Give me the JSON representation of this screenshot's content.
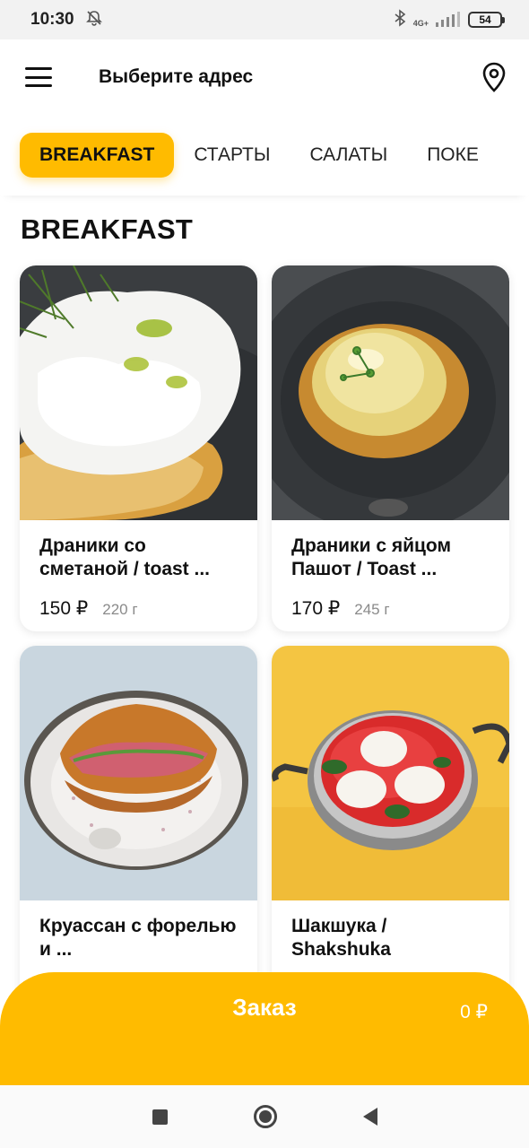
{
  "status_bar": {
    "time": "10:30",
    "network": "4G+",
    "battery": "54"
  },
  "header": {
    "address_label": "Выберите адрес"
  },
  "tabs": [
    {
      "label": "BREAKFAST",
      "active": true
    },
    {
      "label": "СТАРТЫ",
      "active": false
    },
    {
      "label": "САЛАТЫ",
      "active": false
    },
    {
      "label": "ПОКЕ",
      "active": false
    }
  ],
  "section": {
    "title": "BREAKFAST"
  },
  "products": [
    {
      "name": "Драники со сметаной / toast ...",
      "price": "150 ₽",
      "weight": "220 г"
    },
    {
      "name": "Драники с яйцом Пашот / Toast ...",
      "price": "170 ₽",
      "weight": "245 г"
    },
    {
      "name": "Круассан с форелью и ...",
      "price": "",
      "weight": ""
    },
    {
      "name": "Шакшука / Shakshuka",
      "price": "",
      "weight": ""
    }
  ],
  "order": {
    "label": "Заказ",
    "total": "0 ₽"
  },
  "colors": {
    "accent": "#ffbb00"
  }
}
